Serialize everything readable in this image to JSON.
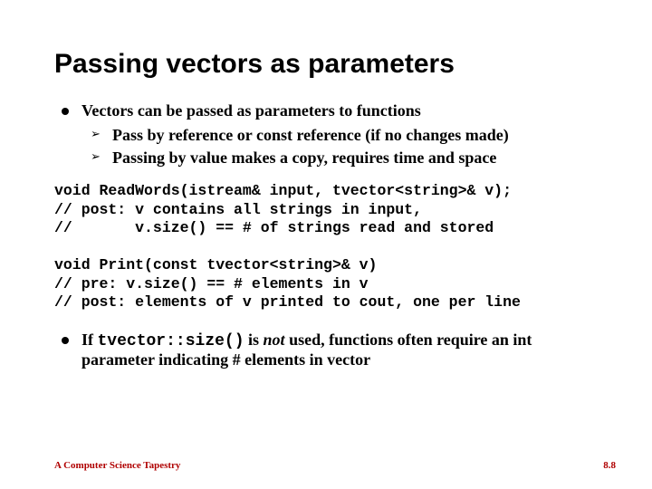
{
  "title": "Passing vectors as parameters",
  "bullets": {
    "b1": {
      "text": "Vectors can be passed as parameters to functions",
      "sub": [
        "Pass by reference or const reference (if no changes made)",
        "Passing by value makes a copy, requires time and space"
      ]
    },
    "b2": {
      "prefix": "If ",
      "code": "tvector::size()",
      "mid": " is ",
      "not": "not",
      "suffix": " used, functions often require an int parameter indicating # elements in vector"
    }
  },
  "code1": "void ReadWords(istream& input, tvector<string>& v);\n// post: v contains all strings in input,\n//       v.size() == # of strings read and stored",
  "code2": "void Print(const tvector<string>& v)\n// pre: v.size() == # elements in v\n// post: elements of v printed to cout, one per line",
  "footer": {
    "left": "A Computer Science Tapestry",
    "right": "8.8"
  }
}
